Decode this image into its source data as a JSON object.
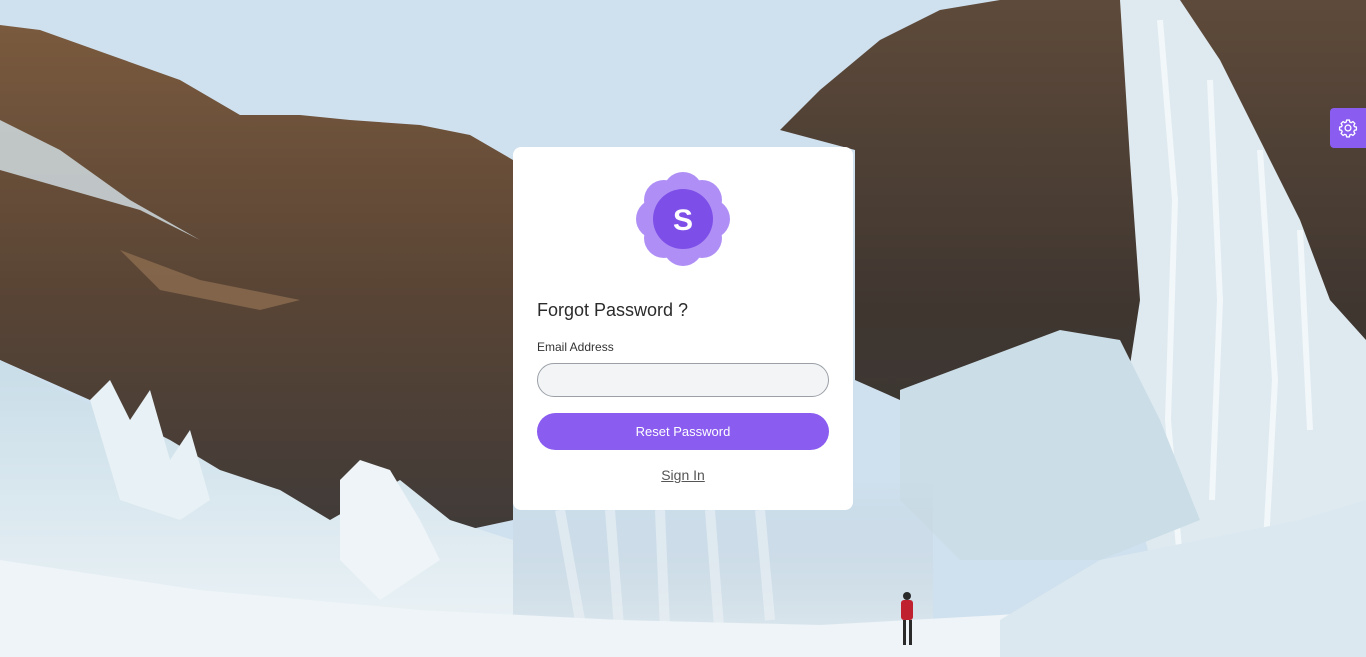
{
  "brand": {
    "logo_letter": "S",
    "accent_color": "#8a5cf0"
  },
  "form": {
    "title": "Forgot Password ?",
    "email_label": "Email Address",
    "email_value": "",
    "email_placeholder": "",
    "submit_label": "Reset Password",
    "signin_link": "Sign In"
  },
  "settings_button": {
    "icon": "gear-icon"
  }
}
